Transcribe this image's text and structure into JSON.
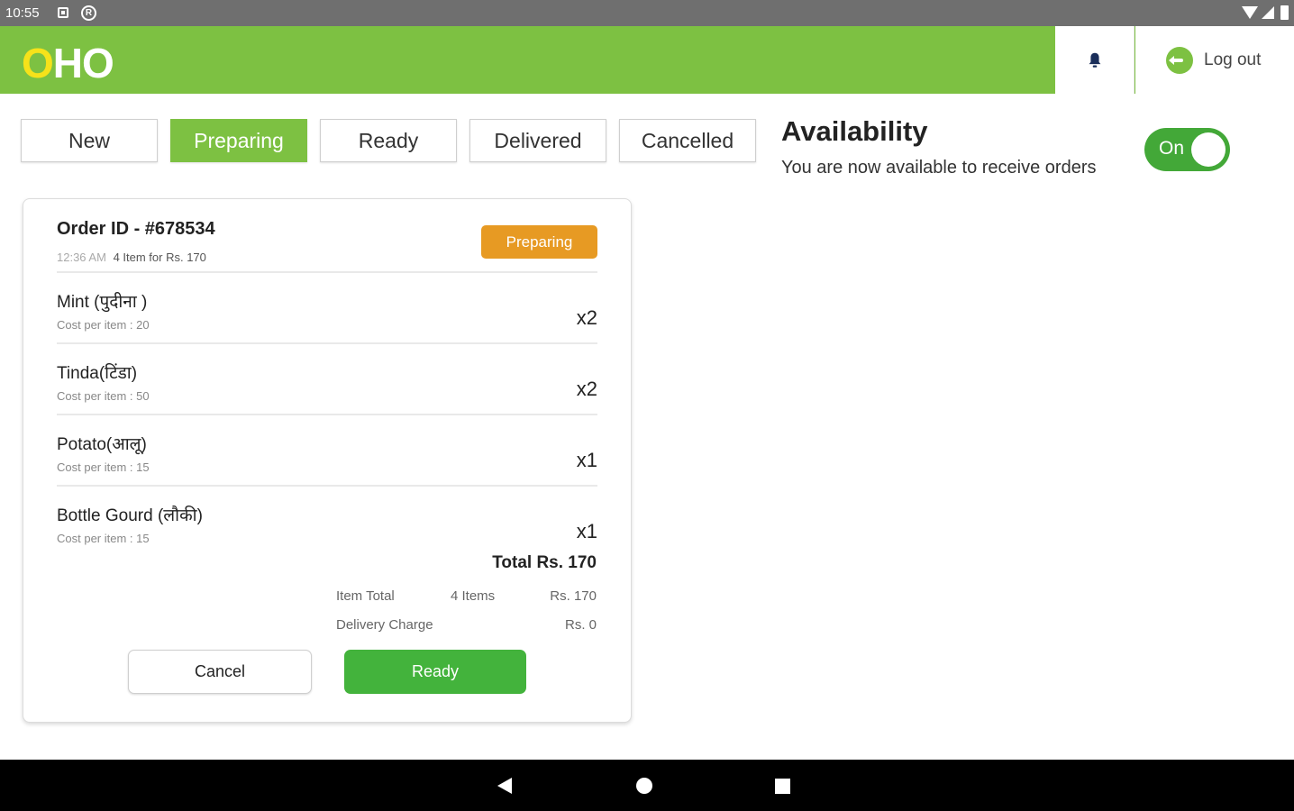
{
  "status_bar": {
    "time": "10:55"
  },
  "header": {
    "logo_o": "O",
    "logo_rest": "HO",
    "logout_label": "Log out"
  },
  "tabs": [
    {
      "label": "New",
      "active": false
    },
    {
      "label": "Preparing",
      "active": true
    },
    {
      "label": "Ready",
      "active": false
    },
    {
      "label": "Delivered",
      "active": false
    },
    {
      "label": "Cancelled",
      "active": false
    }
  ],
  "availability": {
    "title": "Availability",
    "subtitle": "You are now available to receive orders",
    "toggle_label": "On",
    "toggle_on": true
  },
  "order": {
    "id_label": "Order ID - #678534",
    "time": "12:36 AM",
    "summary": "4 Item for Rs. 170",
    "status": "Preparing",
    "items": [
      {
        "name": "Mint (पुदीना )",
        "cost": "Cost per item : 20",
        "qty": "x2"
      },
      {
        "name": "Tinda(टिंडा)",
        "cost": "Cost per item : 50",
        "qty": "x2"
      },
      {
        "name": "Potato(आलू)",
        "cost": "Cost per item : 15",
        "qty": "x1"
      },
      {
        "name": "Bottle Gourd (लौकी)",
        "cost": "Cost per item : 15",
        "qty": "x1"
      }
    ],
    "total": "Total Rs. 170",
    "item_total_label": "Item Total",
    "item_total_count": "4 Items",
    "item_total_value": "Rs. 170",
    "delivery_label": "Delivery Charge",
    "delivery_value": "Rs. 0",
    "cancel_label": "Cancel",
    "ready_label": "Ready"
  },
  "colors": {
    "brand_green": "#7dc142",
    "logo_yellow": "#f6e21a",
    "status_orange": "#e79a23",
    "button_green": "#43b33c"
  }
}
